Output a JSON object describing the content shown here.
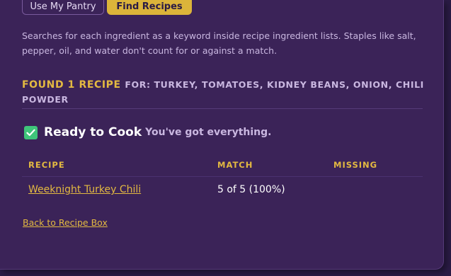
{
  "buttons": {
    "pantry_label": "Use My Pantry",
    "find_label": "Find Recipes"
  },
  "help_text": "Searches for each ingredient as a keyword inside recipe ingredient lists. Staples like salt, pepper, oil, and water don't count for or against a match.",
  "results": {
    "found_label": "Found 1 Recipe",
    "for_label": "for: Turkey, Tomatoes, Kidney Beans, Onion, Chili Powder"
  },
  "section": {
    "icon": "check-icon",
    "title": "Ready to Cook",
    "subtitle": "You've got everything."
  },
  "table": {
    "headers": [
      "Recipe",
      "Match",
      "Missing"
    ],
    "rows": [
      {
        "recipe": "Weeknight Turkey Chili",
        "match": "5 of 5 (100%)",
        "missing": ""
      }
    ]
  },
  "back_link": "Back to Recipe Box",
  "colors": {
    "background": "#3b2358",
    "accent": "#e3b941",
    "check": "#3fc57a"
  }
}
